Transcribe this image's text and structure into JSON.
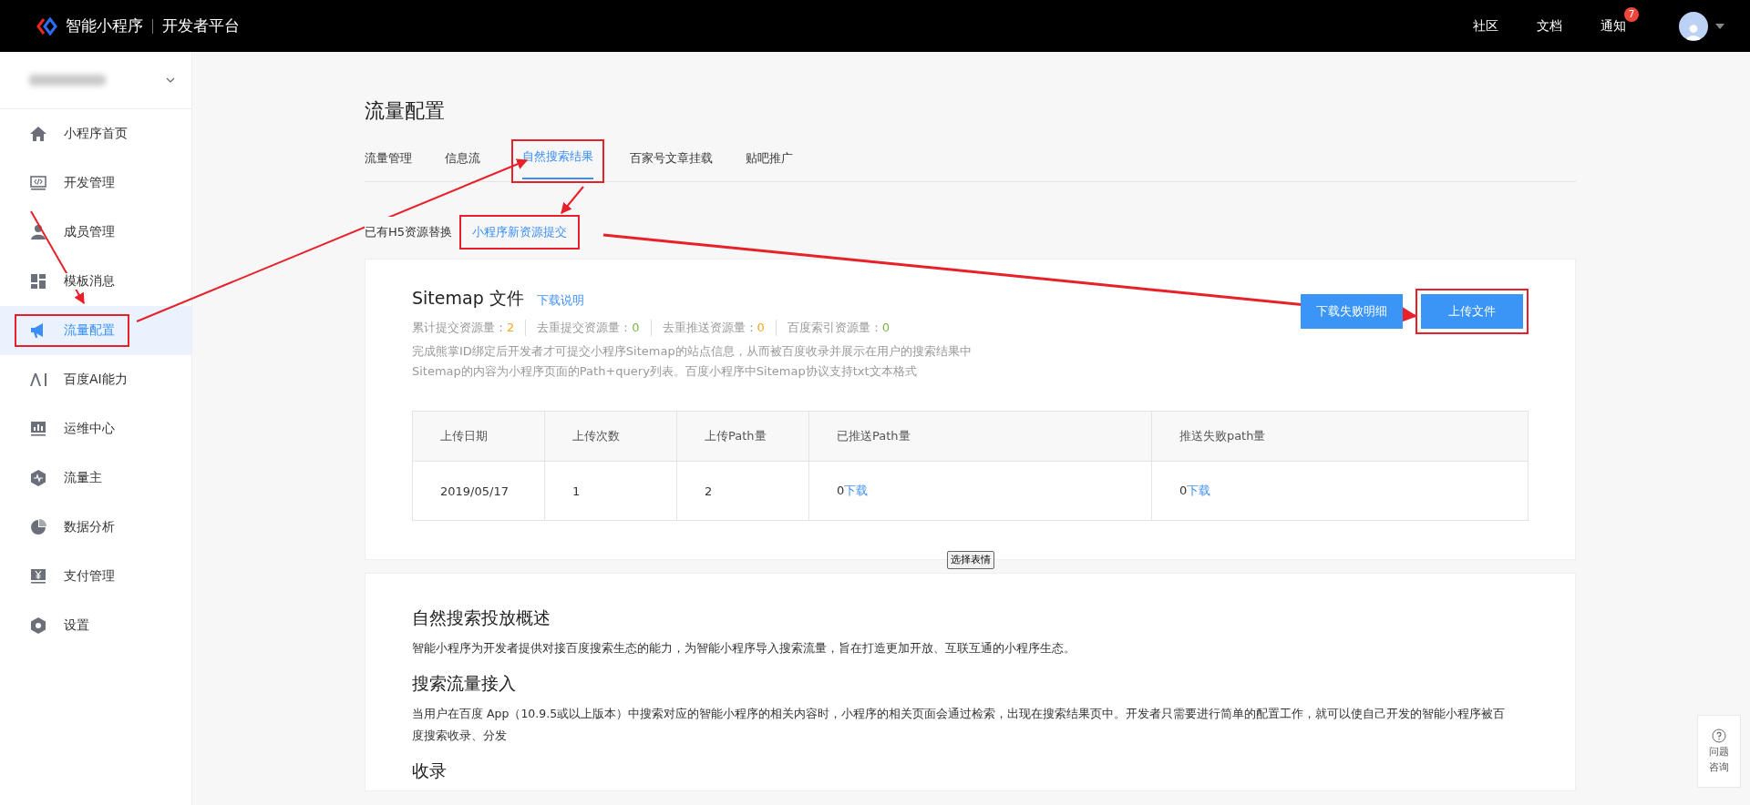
{
  "header": {
    "logo_text": "智能小程序",
    "platform": "开发者平台",
    "nav": [
      {
        "label": "社区"
      },
      {
        "label": "文档"
      },
      {
        "label": "通知",
        "badge": "7"
      }
    ]
  },
  "sidebar": {
    "items": [
      {
        "label": "小程序首页",
        "selected": false,
        "highlighted": false
      },
      {
        "label": "开发管理",
        "selected": false,
        "highlighted": false
      },
      {
        "label": "成员管理",
        "selected": false,
        "highlighted": false
      },
      {
        "label": "模板消息",
        "selected": false,
        "highlighted": false
      },
      {
        "label": "流量配置",
        "selected": true,
        "highlighted": true
      },
      {
        "label": "百度AI能力",
        "selected": false,
        "highlighted": false
      },
      {
        "label": "运维中心",
        "selected": false,
        "highlighted": false
      },
      {
        "label": "流量主",
        "selected": false,
        "highlighted": false
      },
      {
        "label": "数据分析",
        "selected": false,
        "highlighted": false
      },
      {
        "label": "支付管理",
        "selected": false,
        "highlighted": false
      },
      {
        "label": "设置",
        "selected": false,
        "highlighted": false
      }
    ]
  },
  "page_title": "流量配置",
  "tabs": [
    {
      "label": "流量管理",
      "selected": false,
      "highlighted": false
    },
    {
      "label": "信息流",
      "selected": false,
      "highlighted": false
    },
    {
      "label": "自然搜索结果",
      "selected": true,
      "highlighted": true
    },
    {
      "label": "百家号文章挂载",
      "selected": false,
      "highlighted": false
    },
    {
      "label": "贴吧推广",
      "selected": false,
      "highlighted": false
    }
  ],
  "subtabs": [
    {
      "label": "已有H5资源替换",
      "selected": false,
      "highlighted": false
    },
    {
      "label": "小程序新资源提交",
      "selected": true,
      "highlighted": true
    }
  ],
  "sitemap": {
    "title": "Sitemap 文件",
    "help_link": "下载说明",
    "stats": [
      {
        "label": "累计提交资源量：",
        "value": "2",
        "color": "#f5a623"
      },
      {
        "label": "去重提交资源量：",
        "value": "0",
        "color": "#7ab648"
      },
      {
        "label": "去重推送资源量：",
        "value": "0",
        "color": "#f5a623"
      },
      {
        "label": "百度索引资源量：",
        "value": "0",
        "color": "#7ab648"
      }
    ],
    "description": [
      "完成熊掌ID绑定后开发者才可提交小程序Sitemap的站点信息，从而被百度收录并展示在用户的搜索结果中",
      "Sitemap的内容为小程序页面的Path+query列表。百度小程序中Sitemap协议支持txt文本格式"
    ],
    "buttons": [
      {
        "label": "下载失败明细",
        "highlighted": false
      },
      {
        "label": "上传文件",
        "highlighted": true
      }
    ],
    "table": {
      "columns": [
        "上传日期",
        "上传次数",
        "上传Path量",
        "已推送Path量",
        "推送失败path量"
      ],
      "rows": [
        [
          {
            "text": "2019/05/17"
          },
          {
            "text": "1"
          },
          {
            "text": "2"
          },
          {
            "text": "0",
            "link": "下载"
          },
          {
            "text": "0",
            "link": "下载"
          }
        ]
      ]
    }
  },
  "tooltip": "选择表情",
  "overview": {
    "sections": [
      {
        "heading": "自然搜索投放概述",
        "body": "智能小程序为开发者提供对接百度搜索生态的能力，为智能小程序导入搜索流量，旨在打造更加开放、互联互通的小程序生态。"
      },
      {
        "heading": "搜索流量接入",
        "body": "当用户在百度 App（10.9.5或以上版本）中搜索对应的智能小程序的相关内容时，小程序的相关页面会通过检索，出现在搜索结果页中。开发者只需要进行简单的配置工作，就可以使自己开发的智能小程序被百度搜索收录、分发"
      },
      {
        "heading": "收录"
      }
    ]
  },
  "help_button": [
    "问题",
    "咨询"
  ]
}
